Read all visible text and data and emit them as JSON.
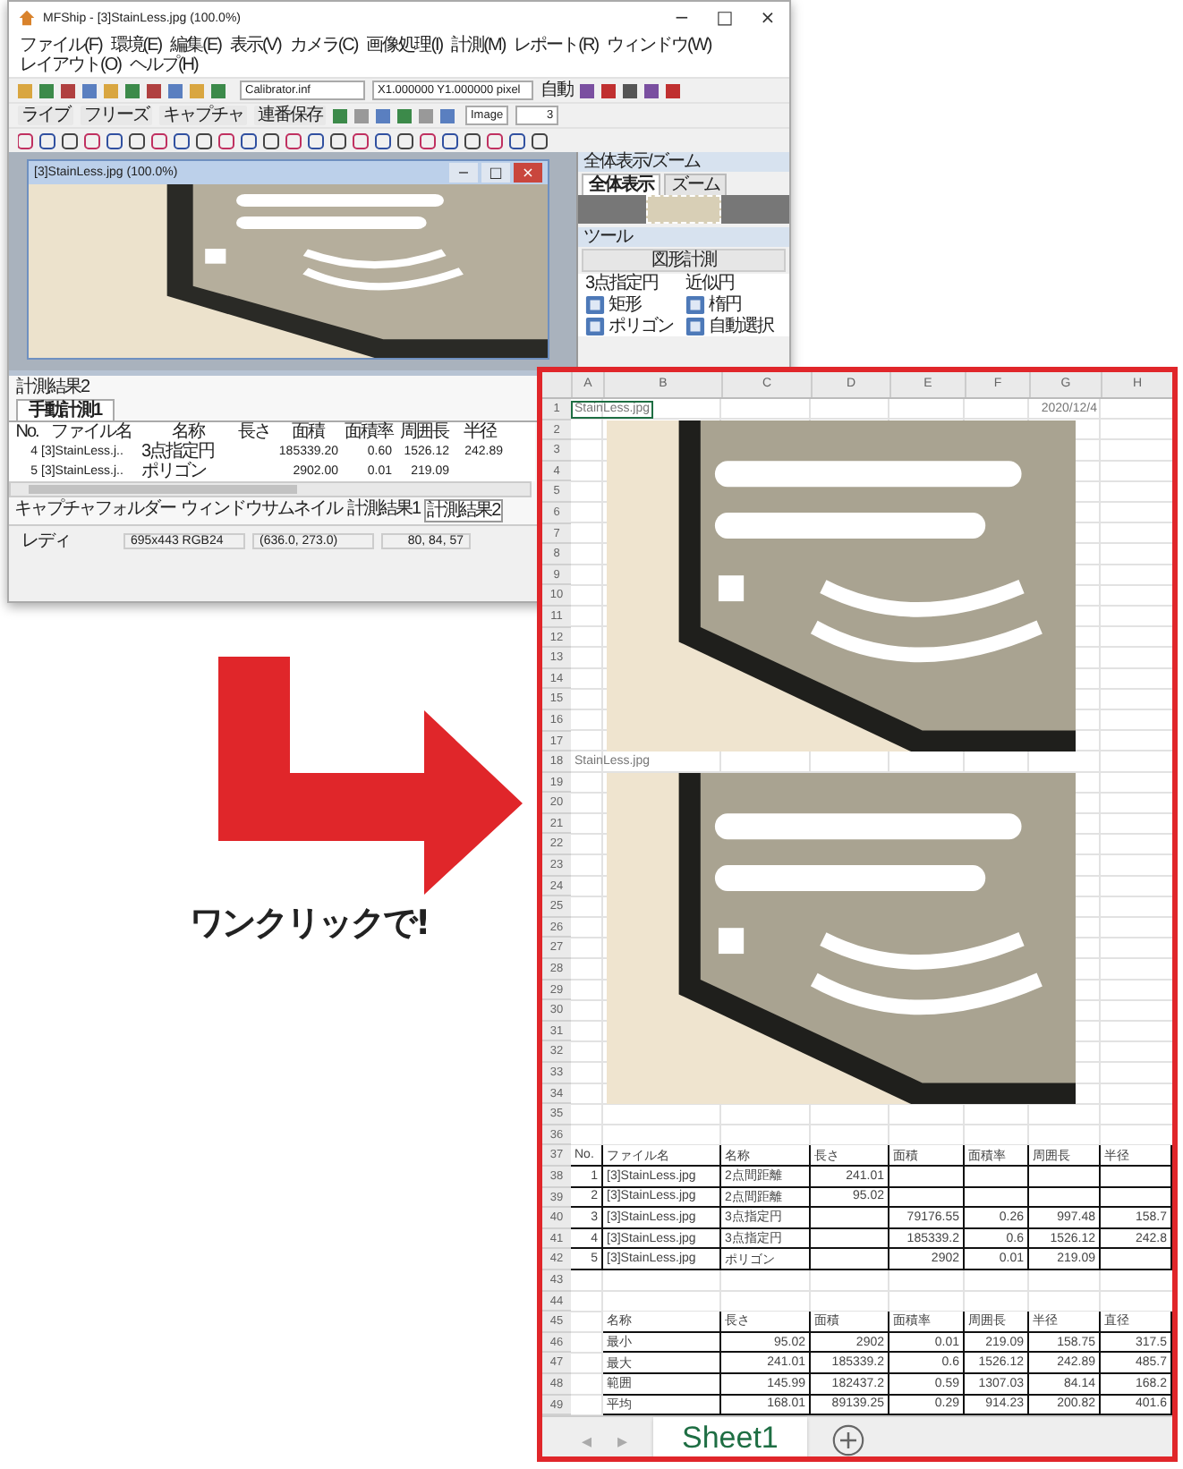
{
  "app_window": {
    "title": "MFShip - [3]StainLess.jpg (100.0%)",
    "controls": [
      "−",
      "□",
      "×"
    ],
    "menu": [
      "ファイル(F)",
      "環境(E)",
      "編集(E)",
      "表示(V)",
      "カメラ(C)",
      "画像処理(I)",
      "計測(M)",
      "レポート(R)",
      "ウィンドウ(W)",
      "レイアウト(O)",
      "ヘルプ(H)"
    ],
    "toolbar1": {
      "calibration": "Calibrator.inf",
      "scale": "X1.000000 Y1.000000 pixel",
      "mode": "自動"
    },
    "toolbar2": {
      "buttons": [
        "ライブ",
        "フリーズ",
        "キャプチャ",
        "連番保存"
      ],
      "image_field": "Image",
      "spin_value": "3"
    },
    "image_window": {
      "title": "[3]StainLess.jpg (100.0%)",
      "controls": [
        "−",
        "□",
        "×"
      ]
    },
    "overview_panel": {
      "title": "全体表示/ズーム",
      "tabs": [
        {
          "label": "全体表示",
          "selected": true
        },
        {
          "label": "ズーム",
          "selected": false
        }
      ]
    },
    "tool_panel": {
      "title": "ツール",
      "section": "図形計測",
      "tools": [
        {
          "label": "3点指定円",
          "kind": "text"
        },
        {
          "label": "近似円",
          "kind": "text"
        },
        {
          "label": "矩形",
          "kind": "icon"
        },
        {
          "label": "楕円",
          "kind": "icon"
        },
        {
          "label": "ポリゴン",
          "kind": "icon"
        },
        {
          "label": "自動選択",
          "kind": "icon"
        }
      ]
    },
    "results_panel": {
      "title": "計測結果2",
      "tabs": [
        {
          "label": "手動計測1",
          "selected": true
        }
      ],
      "columns": [
        "No.",
        "ファイル名",
        "名称",
        "長さ",
        "面積",
        "面積率",
        "周囲長",
        "半径"
      ],
      "rows": [
        [
          "4",
          "[3]StainLess.j..",
          "3点指定円",
          null,
          "185339.20",
          "0.60",
          "1526.12",
          "242.89"
        ],
        [
          "5",
          "[3]StainLess.j..",
          "ポリゴン",
          null,
          "2902.00",
          "0.01",
          "219.09",
          null
        ]
      ]
    },
    "bottom_tabs": [
      {
        "label": "キャプチャフォルダー",
        "selected": false
      },
      {
        "label": "ウィンドウサムネイル",
        "selected": false
      },
      {
        "label": "計測結果1",
        "selected": false
      },
      {
        "label": "計測結果2",
        "selected": true
      }
    ],
    "status_bar": [
      "レディ",
      "695x443 RGB24",
      "(636.0, 273.0)",
      "80, 84, 57"
    ]
  },
  "caption": "ワンクリックで!",
  "spreadsheet": {
    "columns": [
      "A",
      "B",
      "C",
      "D",
      "E",
      "F",
      "G",
      "H"
    ],
    "rows": [
      {
        "number": "1",
        "kind": "title",
        "cells": [
          {
            "text": "StainLess.jpg",
            "selected": true
          },
          null,
          null,
          null,
          null,
          null,
          {
            "text": "2020/12/4",
            "selected": false
          },
          null
        ]
      },
      {
        "number": "2"
      },
      {
        "number": "3"
      },
      {
        "number": "4"
      },
      {
        "number": "5"
      },
      {
        "number": "6"
      },
      {
        "number": "7"
      },
      {
        "number": "8"
      },
      {
        "number": "9"
      },
      {
        "number": "10"
      },
      {
        "number": "11"
      },
      {
        "number": "12"
      },
      {
        "number": "13"
      },
      {
        "number": "14"
      },
      {
        "number": "15"
      },
      {
        "number": "16"
      },
      {
        "number": "17"
      },
      {
        "number": "18",
        "kind": "title",
        "cells": [
          {
            "text": "StainLess.jpg",
            "selected": false
          },
          null,
          null,
          null,
          null,
          null,
          null,
          null
        ]
      },
      {
        "number": "19"
      },
      {
        "number": "20"
      },
      {
        "number": "21"
      },
      {
        "number": "22"
      },
      {
        "number": "23"
      },
      {
        "number": "24"
      },
      {
        "number": "25"
      },
      {
        "number": "26"
      },
      {
        "number": "27"
      },
      {
        "number": "28"
      },
      {
        "number": "29"
      },
      {
        "number": "30"
      },
      {
        "number": "31"
      },
      {
        "number": "32"
      },
      {
        "number": "33"
      },
      {
        "number": "34"
      },
      {
        "number": "35"
      },
      {
        "number": "36"
      },
      {
        "number": "37",
        "kind": "header",
        "cells": [
          "No.",
          "ファイル名",
          "名称",
          "長さ",
          "面積",
          "面積率",
          "周囲長",
          "半径"
        ]
      },
      {
        "number": "38",
        "kind": "record",
        "cells": [
          "1",
          "[3]StainLess.jpg",
          "2点間距離",
          "241.01",
          null,
          null,
          null,
          null
        ]
      },
      {
        "number": "39",
        "kind": "record",
        "cells": [
          "2",
          "[3]StainLess.jpg",
          "2点間距離",
          "95.02",
          null,
          null,
          null,
          null
        ]
      },
      {
        "number": "40",
        "kind": "record",
        "cells": [
          "3",
          "[3]StainLess.jpg",
          "3点指定円",
          null,
          "79176.55",
          "0.26",
          "997.48",
          "158.7"
        ]
      },
      {
        "number": "41",
        "kind": "record",
        "cells": [
          "4",
          "[3]StainLess.jpg",
          "3点指定円",
          null,
          "185339.2",
          "0.6",
          "1526.12",
          "242.8"
        ]
      },
      {
        "number": "42",
        "kind": "record",
        "cells": [
          "5",
          "[3]StainLess.jpg",
          "ポリゴン",
          null,
          "2902",
          "0.01",
          "219.09",
          null
        ]
      },
      {
        "number": "43"
      },
      {
        "number": "44"
      },
      {
        "number": "45",
        "kind": "header",
        "cells": [
          null,
          "名称",
          "長さ",
          "面積",
          "面積率",
          "周囲長",
          "半径",
          "直径"
        ]
      },
      {
        "number": "46",
        "kind": "summary",
        "cells": [
          null,
          "最小",
          "95.02",
          "2902",
          "0.01",
          "219.09",
          "158.75",
          "317.5"
        ]
      },
      {
        "number": "47",
        "kind": "summary",
        "cells": [
          null,
          "最大",
          "241.01",
          "185339.2",
          "0.6",
          "1526.12",
          "242.89",
          "485.7"
        ]
      },
      {
        "number": "48",
        "kind": "summary",
        "cells": [
          null,
          "範囲",
          "145.99",
          "182437.2",
          "0.59",
          "1307.03",
          "84.14",
          "168.2"
        ]
      },
      {
        "number": "49",
        "kind": "summary",
        "cells": [
          null,
          "平均",
          "168.01",
          "89139.25",
          "0.29",
          "914.23",
          "200.82",
          "401.6"
        ]
      }
    ],
    "nav": [
      "◂",
      "▸"
    ],
    "tabs": [
      {
        "label": "Sheet1",
        "selected": true
      }
    ]
  }
}
